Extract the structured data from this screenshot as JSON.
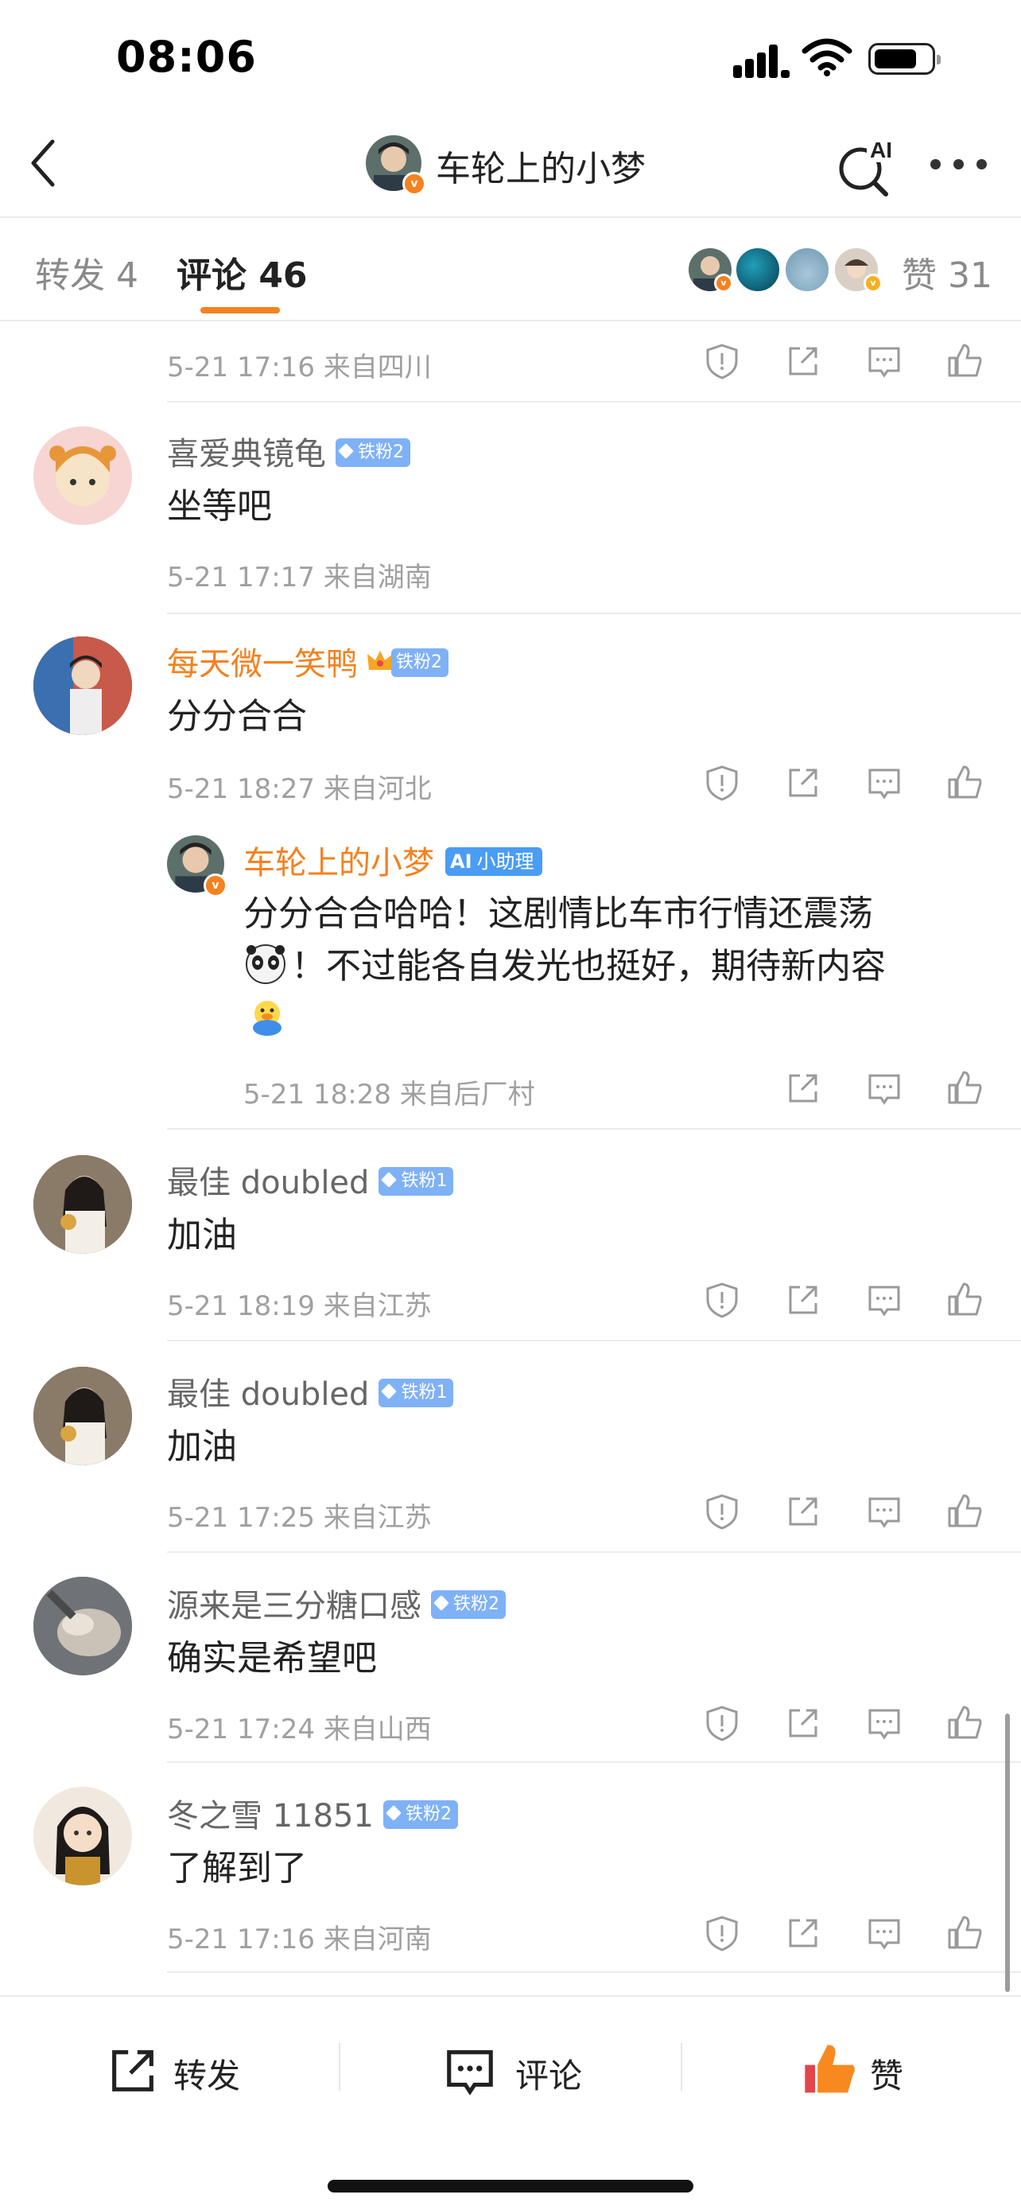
{
  "status_bar": {
    "time": "08:06"
  },
  "nav": {
    "title": "车轮上的小梦",
    "ai_label": "AI"
  },
  "tabs": [
    {
      "label": "转发 4"
    },
    {
      "label": "评论 46"
    }
  ],
  "likes_label": "赞 31",
  "colors": {
    "accent": "#f5811f",
    "fan_badge": "#7fb1f7",
    "ai_badge": "#4a9cf5"
  },
  "top_meta": "5-21 17:16  来自四川",
  "comments": [
    {
      "name": "喜爱典镜龟",
      "badge": "铁粉2",
      "text": "坐等吧",
      "meta": "5-21 17:17  来自湖南"
    },
    {
      "name": "每天微一笑鸭",
      "badge": "铁粉2",
      "text": "分分合合",
      "meta": "5-21 18:27  来自河北"
    },
    {
      "name": "最佳 doubled",
      "badge": "铁粉1",
      "text": "加油",
      "meta": "5-21 18:19  来自江苏"
    },
    {
      "name": "最佳 doubled",
      "badge": "铁粉1",
      "text": "加油",
      "meta": "5-21 17:25  来自江苏"
    },
    {
      "name": "源来是三分糖口感",
      "badge": "铁粉2",
      "text": "确实是希望吧",
      "meta": "5-21 17:24  来自山西"
    },
    {
      "name": "冬之雪 11851",
      "badge": "铁粉2",
      "text": "了解到了",
      "meta": "5-21 17:16  来自河南"
    }
  ],
  "reply": {
    "name": "车轮上的小梦",
    "badge": "小助理",
    "line1": "分分合合哈哈！这剧情比车市行情还震荡",
    "line2": "！不过能各自发光也挺好，期待新内容",
    "meta": "5-21 18:28  来自后厂村"
  },
  "bottom_bar": {
    "repost": "转发",
    "comment": "评论",
    "like": "赞"
  }
}
